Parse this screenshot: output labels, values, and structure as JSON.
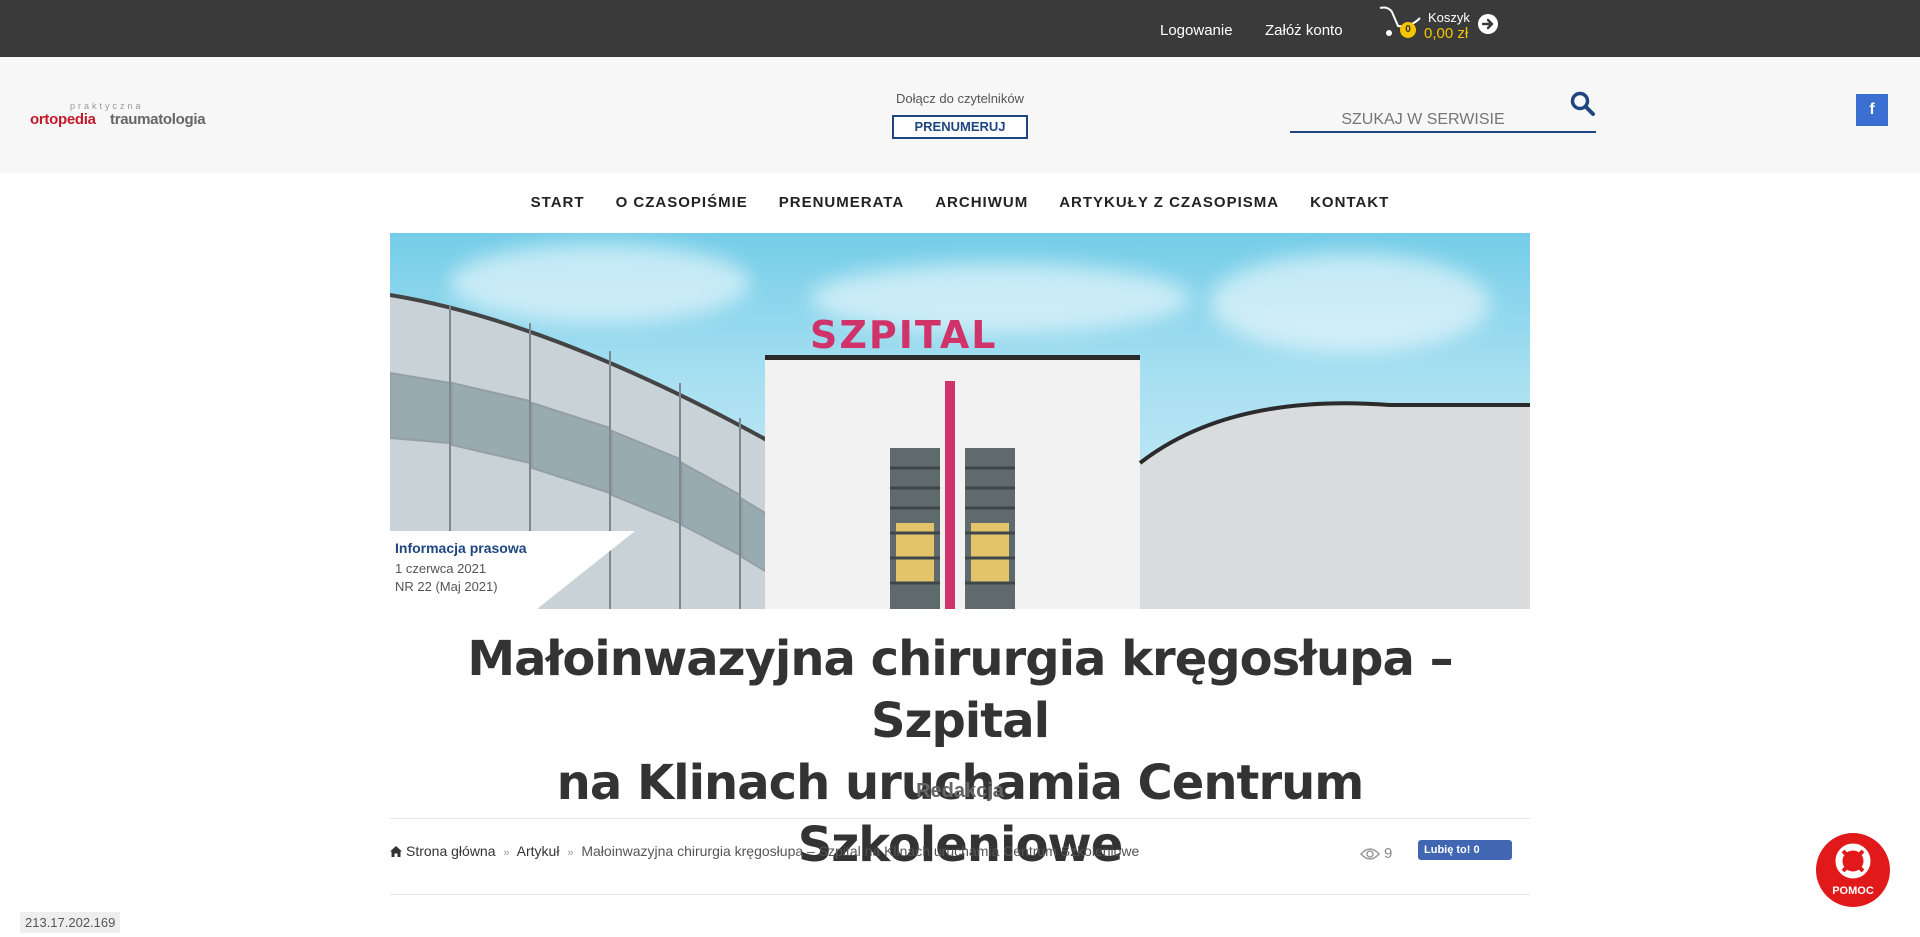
{
  "topbar": {
    "login": "Logowanie",
    "register": "Załóż konto",
    "cart_label": "Koszyk",
    "cart_count": "0",
    "cart_total": "0,00 zł"
  },
  "header": {
    "logo_pre": "praktyczna",
    "logo_a": "ortopedia",
    "logo_b": "traumatologia",
    "join_text": "Dołącz do czytelników",
    "subscribe_label": "PRENUMERUJ",
    "search_placeholder": "SZUKAJ W SERWISIE",
    "facebook_label": "f"
  },
  "nav": {
    "items": [
      "START",
      "O CZASOPIŚMIE",
      "PRENUMERATA",
      "ARCHIWUM",
      "ARTYKUŁY Z CZASOPISMA",
      "KONTAKT"
    ]
  },
  "hero": {
    "sign": "SZPITAL",
    "category": "Informacja prasowa",
    "date": "1 czerwca 2021",
    "issue": "NR 22 (Maj 2021)"
  },
  "article": {
    "title_line1": "Małoinwazyjna chirurgia kręgosłupa – Szpital",
    "title_line2": "na Klinach uruchamia Centrum Szkoleniowe",
    "author": "Redakcja"
  },
  "breadcrumb": {
    "home": "Strona główna",
    "section": "Artykuł",
    "current": "Małoinwazyjna chirurgia kręgosłupa – Szpital na Klinach uruchamia Centrum Szkoleniowe",
    "separator": "»"
  },
  "views": "9",
  "like_label": "Lubię to! 0",
  "ip": "213.17.202.169",
  "help_label": "POMOC",
  "colors": {
    "topbar": "#3a3a3a",
    "accent_blue": "#1f4680",
    "cart_yellow": "#f5c400",
    "help_red": "#e1191b",
    "sign_pink": "#d0336a"
  }
}
